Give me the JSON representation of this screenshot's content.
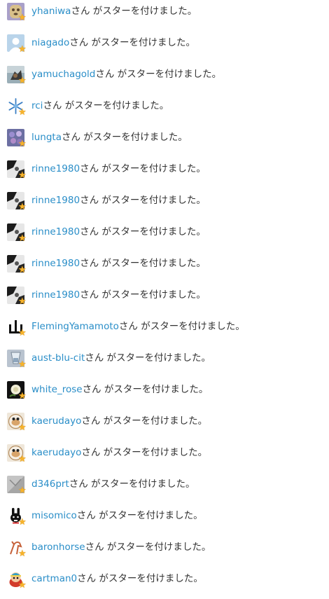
{
  "colors": {
    "link": "#2a8ec8",
    "text": "#333333",
    "star": "#f7b32b"
  },
  "suffix": "さん がスターを付けました。",
  "stars": [
    {
      "user": "yhaniwa",
      "avatar_icon": "clay-figure-icon"
    },
    {
      "user": "niagado",
      "avatar_icon": "default-silhouette-icon"
    },
    {
      "user": "yamuchagold",
      "avatar_icon": "photo-avatar-icon"
    },
    {
      "user": "rci",
      "avatar_icon": "snowflake-icon"
    },
    {
      "user": "lungta",
      "avatar_icon": "flowers-icon"
    },
    {
      "user": "rinne1980",
      "avatar_icon": "cat-photo-icon"
    },
    {
      "user": "rinne1980",
      "avatar_icon": "cat-photo-icon"
    },
    {
      "user": "rinne1980",
      "avatar_icon": "cat-photo-icon"
    },
    {
      "user": "rinne1980",
      "avatar_icon": "cat-photo-icon"
    },
    {
      "user": "rinne1980",
      "avatar_icon": "cat-photo-icon"
    },
    {
      "user": "FlemingYamamoto",
      "avatar_icon": "mountain-kanji-icon"
    },
    {
      "user": "aust-blu-cit",
      "avatar_icon": "glass-photo-icon"
    },
    {
      "user": "white_rose",
      "avatar_icon": "white-rose-icon"
    },
    {
      "user": "kaerudayo",
      "avatar_icon": "frog-plate-icon"
    },
    {
      "user": "kaerudayo",
      "avatar_icon": "frog-plate-icon"
    },
    {
      "user": "d346prt",
      "avatar_icon": "grey-photo-icon"
    },
    {
      "user": "misomico",
      "avatar_icon": "rabbit-icon"
    },
    {
      "user": "baronhorse",
      "avatar_icon": "horse-icon"
    },
    {
      "user": "cartman0",
      "avatar_icon": "cartman-icon"
    }
  ]
}
